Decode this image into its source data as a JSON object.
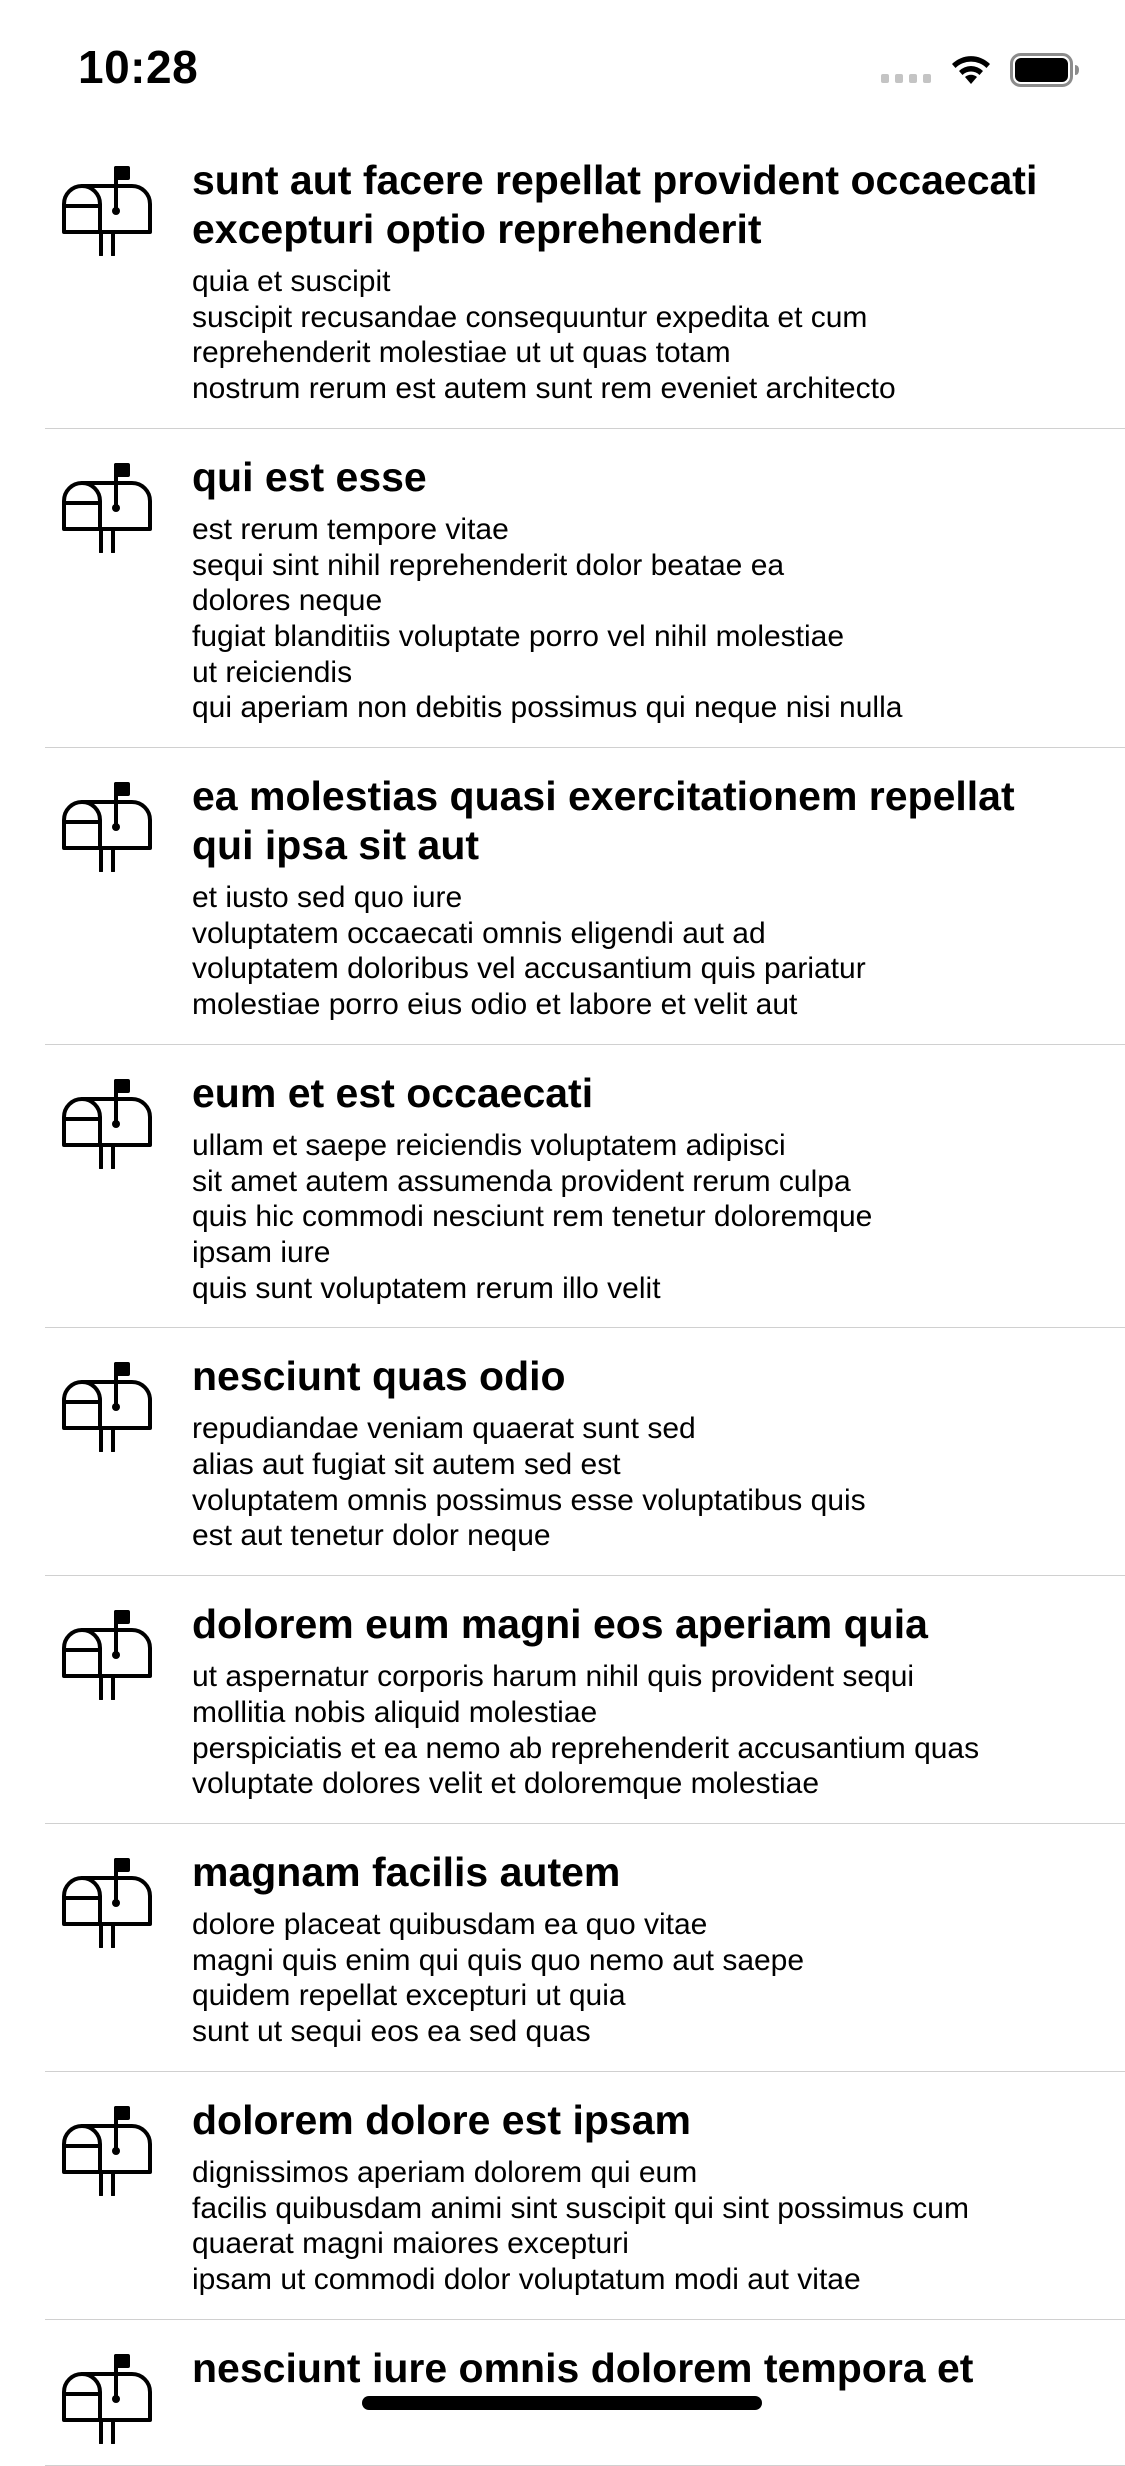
{
  "status_bar": {
    "time": "10:28",
    "signal_icon": "cellular-signal-icon",
    "wifi_icon": "wifi-icon",
    "battery_icon": "battery-icon"
  },
  "row_icon": "mailbox-icon",
  "posts": [
    {
      "title": "sunt aut facere repellat provident occaecati excepturi optio reprehenderit",
      "body": "quia et suscipit\nsuscipit recusandae consequuntur expedita et cum\nreprehenderit molestiae ut ut quas totam\nnostrum rerum est autem sunt rem eveniet architecto"
    },
    {
      "title": "qui est esse",
      "body": "est rerum tempore vitae\nsequi sint nihil reprehenderit dolor beatae ea\ndolores neque\nfugiat blanditiis voluptate porro vel nihil molestiae\nut reiciendis\nqui aperiam non debitis possimus qui neque nisi nulla"
    },
    {
      "title": "ea molestias quasi exercitationem repellat qui ipsa sit aut",
      "body": "et iusto sed quo iure\nvoluptatem occaecati omnis eligendi aut ad\nvoluptatem doloribus vel accusantium quis pariatur\nmolestiae porro eius odio et labore et velit aut"
    },
    {
      "title": "eum et est occaecati",
      "body": "ullam et saepe reiciendis voluptatem adipisci\nsit amet autem assumenda provident rerum culpa\nquis hic commodi nesciunt rem tenetur doloremque\nipsam iure\nquis sunt voluptatem rerum illo velit"
    },
    {
      "title": "nesciunt quas odio",
      "body": "repudiandae veniam quaerat sunt sed\nalias aut fugiat sit autem sed est\nvoluptatem omnis possimus esse voluptatibus quis\nest aut tenetur dolor neque"
    },
    {
      "title": "dolorem eum magni eos aperiam quia",
      "body": "ut aspernatur corporis harum nihil quis provident sequi\nmollitia nobis aliquid molestiae\nperspiciatis et ea nemo ab reprehenderit accusantium quas\nvoluptate dolores velit et doloremque molestiae"
    },
    {
      "title": "magnam facilis autem",
      "body": "dolore placeat quibusdam ea quo vitae\nmagni quis enim qui quis quo nemo aut saepe\nquidem repellat excepturi ut quia\nsunt ut sequi eos ea sed quas"
    },
    {
      "title": "dolorem dolore est ipsam",
      "body": "dignissimos aperiam dolorem qui eum\nfacilis quibusdam animi sint suscipit qui sint possimus cum\nquaerat magni maiores excepturi\nipsam ut commodi dolor voluptatum modi aut vitae"
    },
    {
      "title": "nesciunt iure omnis dolorem tempora et",
      "body": ""
    }
  ]
}
